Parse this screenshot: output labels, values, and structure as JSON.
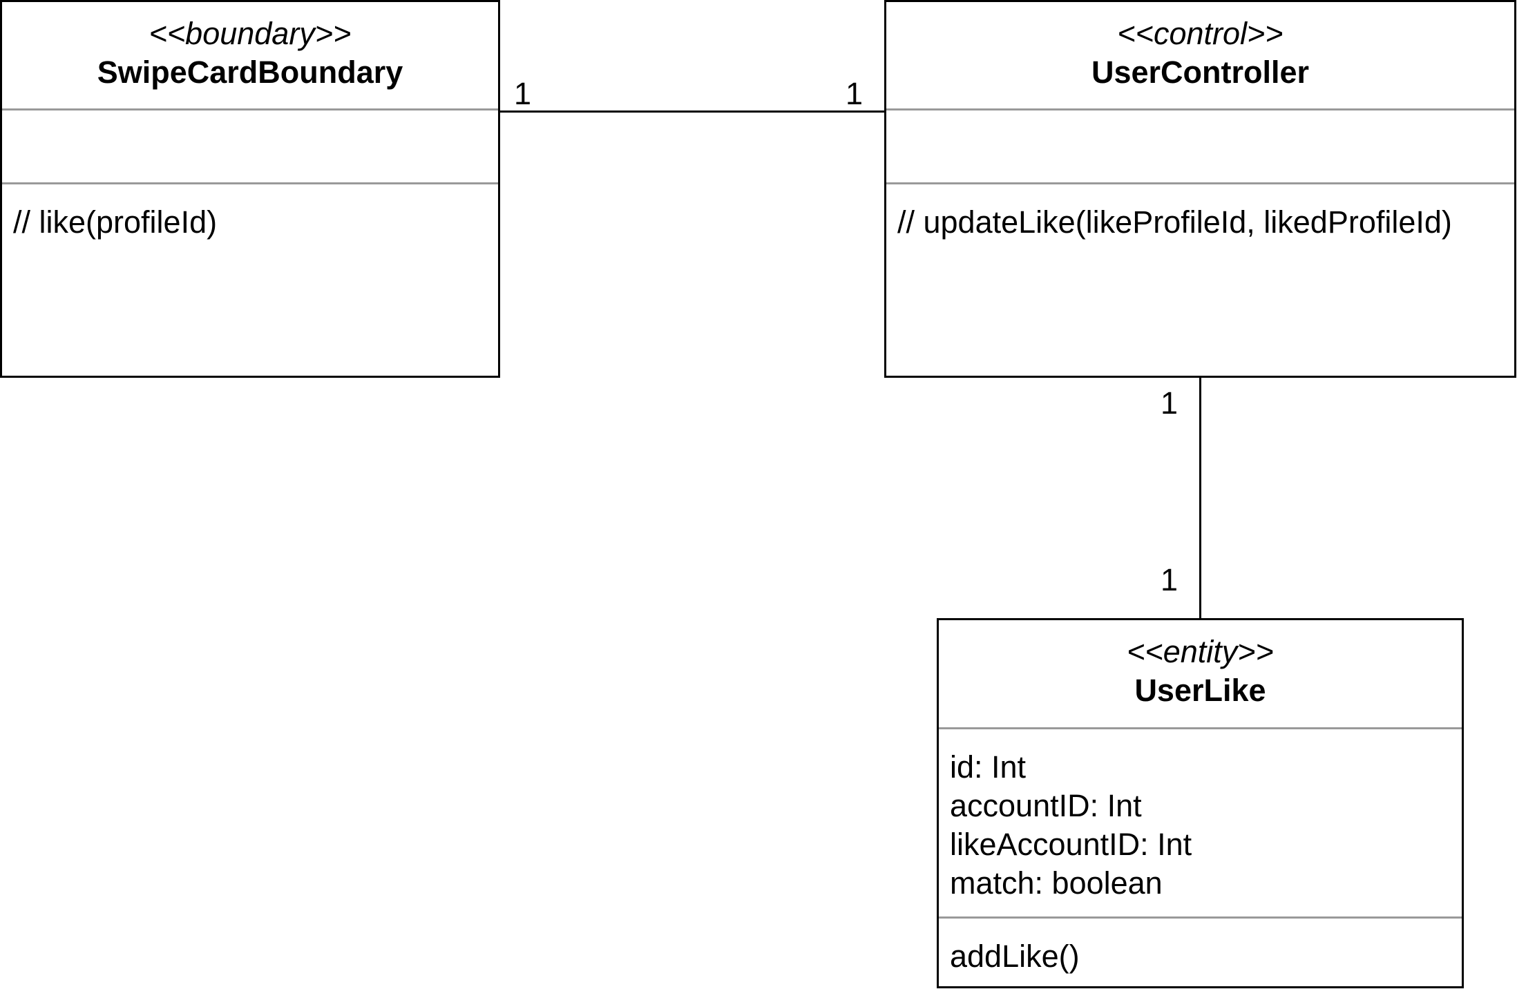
{
  "diagram": {
    "classes": [
      {
        "id": "swipe-card-boundary",
        "stereotype": "<<boundary>>",
        "name": "SwipeCardBoundary",
        "attributes": [],
        "operations": [
          "// like(profileId)"
        ]
      },
      {
        "id": "user-controller",
        "stereotype": "<<control>>",
        "name": "UserController",
        "attributes": [],
        "operations": [
          "// updateLike(likeProfileId, likedProfileId)"
        ]
      },
      {
        "id": "user-like",
        "stereotype": "<<entity>>",
        "name": "UserLike",
        "attributes": [
          "id: Int",
          "accountID: Int",
          "likeAccountID: Int",
          "match: boolean"
        ],
        "operations": [
          "addLike()"
        ]
      }
    ],
    "associations": [
      {
        "from": "SwipeCardBoundary",
        "to": "UserController",
        "from_multiplicity": "1",
        "to_multiplicity": "1"
      },
      {
        "from": "UserController",
        "to": "UserLike",
        "from_multiplicity": "1",
        "to_multiplicity": "1"
      }
    ]
  }
}
